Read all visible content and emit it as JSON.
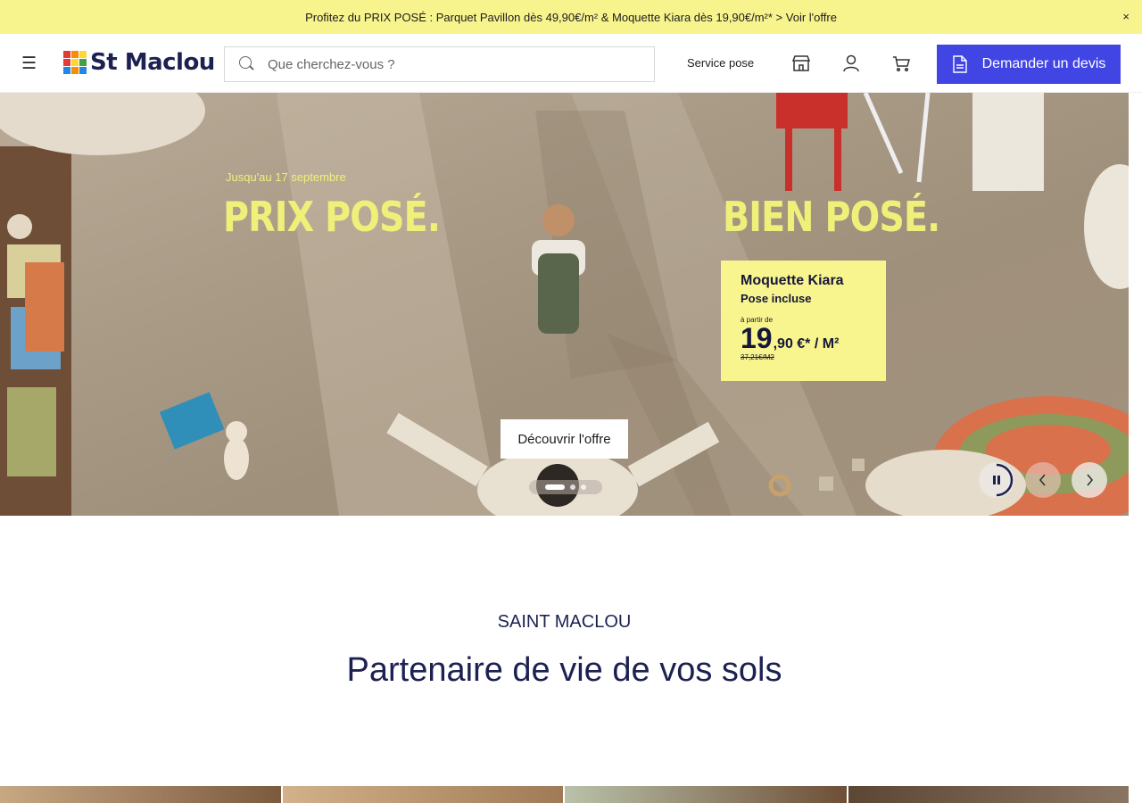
{
  "promo": {
    "text": "Profitez du PRIX POSÉ : Parquet Pavillon dès 49,90€/m² & Moquette Kiara dès 19,90€/m²* > Voir l'offre",
    "close": "×"
  },
  "header": {
    "menu_icon": "☰",
    "logo_text": "St Maclou",
    "search_placeholder": "Que cherchez-vous ?",
    "service_label": "Service pose",
    "quote_button": "Demander un devis",
    "icons": [
      "store-icon",
      "user-icon",
      "cart-icon"
    ]
  },
  "hero": {
    "date_text": "Jusqu'au 17 septembre",
    "left_title": "PRIX POSÉ.",
    "right_title": "BIEN POSÉ.",
    "card": {
      "title": "Moquette Kiara",
      "subtitle": "Pose incluse",
      "from": "à partir de",
      "price_int": "19",
      "price_dec": ",90 €* / M²",
      "old_price": "37,21€/M2"
    },
    "cta": "Découvrir l'offre",
    "slide_count": 3,
    "active_slide": 1
  },
  "section": {
    "kicker": "SAINT MACLOU",
    "headline": "Partenaire de vie de vos sols"
  },
  "colors": {
    "promo_bg": "#f7f48e",
    "brand_navy": "#1c2152",
    "cta_blue": "#4145e4",
    "hero_accent": "#eef07a"
  }
}
